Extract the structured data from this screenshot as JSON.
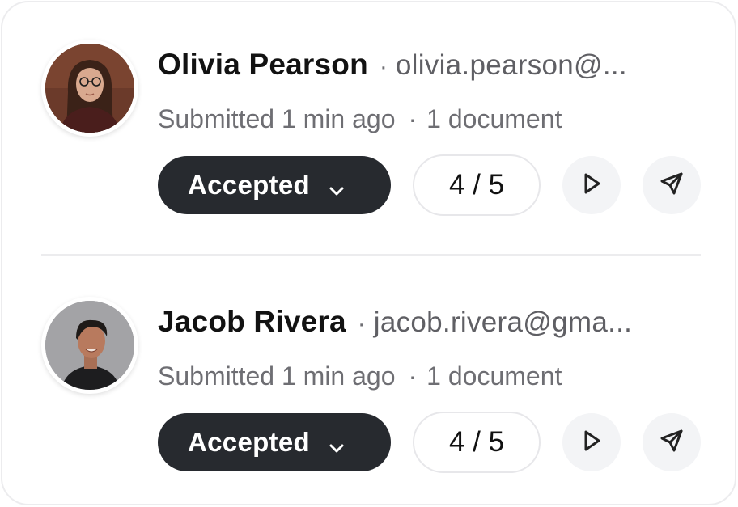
{
  "submissions": [
    {
      "name": "Olivia Pearson",
      "email": "olivia.pearson@...",
      "submitted": "Submitted 1 min ago",
      "documents": "1 document",
      "status": "Accepted",
      "score": "4 / 5"
    },
    {
      "name": "Jacob Rivera",
      "email": "jacob.rivera@gma...",
      "submitted": "Submitted 1 min ago",
      "documents": "1 document",
      "status": "Accepted",
      "score": "4 / 5"
    }
  ],
  "separator": "·",
  "icons": {
    "status_toggle": "chevron-down-icon",
    "play": "play-icon",
    "send": "send-icon"
  },
  "colors": {
    "status_button_bg": "#272a2f",
    "icon_button_bg": "#f3f4f6",
    "border": "#ececee"
  }
}
